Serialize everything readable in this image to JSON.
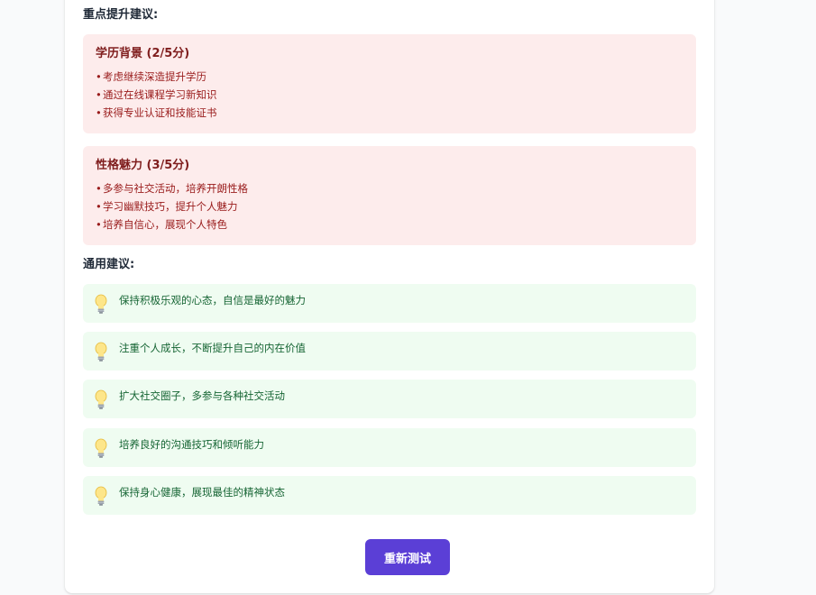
{
  "improvement": {
    "heading": "重点提升建议:",
    "items": [
      {
        "title": "学历背景 (2/5分)",
        "suggestions": [
          "考虑继续深造提升学历",
          "通过在线课程学习新知识",
          "获得专业认证和技能证书"
        ]
      },
      {
        "title": "性格魅力 (3/5分)",
        "suggestions": [
          "多参与社交活动，培养开朗性格",
          "学习幽默技巧，提升个人魅力",
          "培养自信心，展现个人特色"
        ]
      }
    ]
  },
  "general": {
    "heading": "通用建议:",
    "icon": "lightbulb-icon",
    "tips": [
      "保持积极乐观的心态，自信是最好的魅力",
      "注重个人成长，不断提升自己的内在价值",
      "扩大社交圈子，多参与各种社交活动",
      "培养良好的沟通技巧和倾听能力",
      "保持身心健康，展现最佳的精神状态"
    ]
  },
  "actions": {
    "retest_label": "重新测试"
  },
  "colors": {
    "improve_bg": "#fdecec",
    "improve_title": "#7f1d1d",
    "improve_text": "#991b1b",
    "tip_bg": "#effcf1",
    "tip_text": "#166534",
    "button_bg": "#5b3fd6"
  }
}
